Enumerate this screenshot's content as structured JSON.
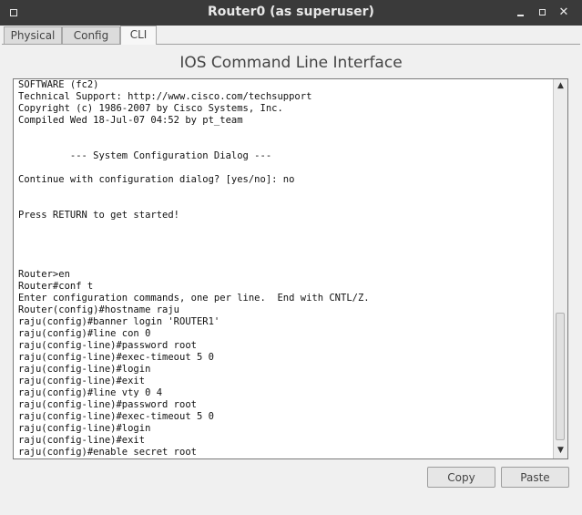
{
  "window": {
    "title": "Router0 (as superuser)",
    "menu_icon": "window-menu-icon",
    "minimize_glyph": "",
    "maximize_glyph": "",
    "close_glyph": "✕"
  },
  "tabs": [
    {
      "label": "Physical",
      "active": false
    },
    {
      "label": "Config",
      "active": false
    },
    {
      "label": "CLI",
      "active": true
    }
  ],
  "heading": "IOS Command Line Interface",
  "terminal": {
    "text": "SOFTWARE (fc2)\nTechnical Support: http://www.cisco.com/techsupport\nCopyright (c) 1986-2007 by Cisco Systems, Inc.\nCompiled Wed 18-Jul-07 04:52 by pt_team\n\n\n         --- System Configuration Dialog ---\n\nContinue with configuration dialog? [yes/no]: no\n\n\nPress RETURN to get started!\n\n\n\n\nRouter>en\nRouter#conf t\nEnter configuration commands, one per line.  End with CNTL/Z.\nRouter(config)#hostname raju\nraju(config)#banner login 'ROUTER1'\nraju(config)#line con 0\nraju(config-line)#password root\nraju(config-line)#exec-timeout 5 0\nraju(config-line)#login\nraju(config-line)#exit\nraju(config)#line vty 0 4\nraju(config-line)#password root\nraju(config-line)#exec-timeout 5 0\nraju(config-line)#login\nraju(config-line)#exit\nraju(config)#enable secret root\nraju(config)#",
    "scroll_up_glyph": "▲",
    "scroll_down_glyph": "▼"
  },
  "buttons": {
    "copy": "Copy",
    "paste": "Paste"
  }
}
